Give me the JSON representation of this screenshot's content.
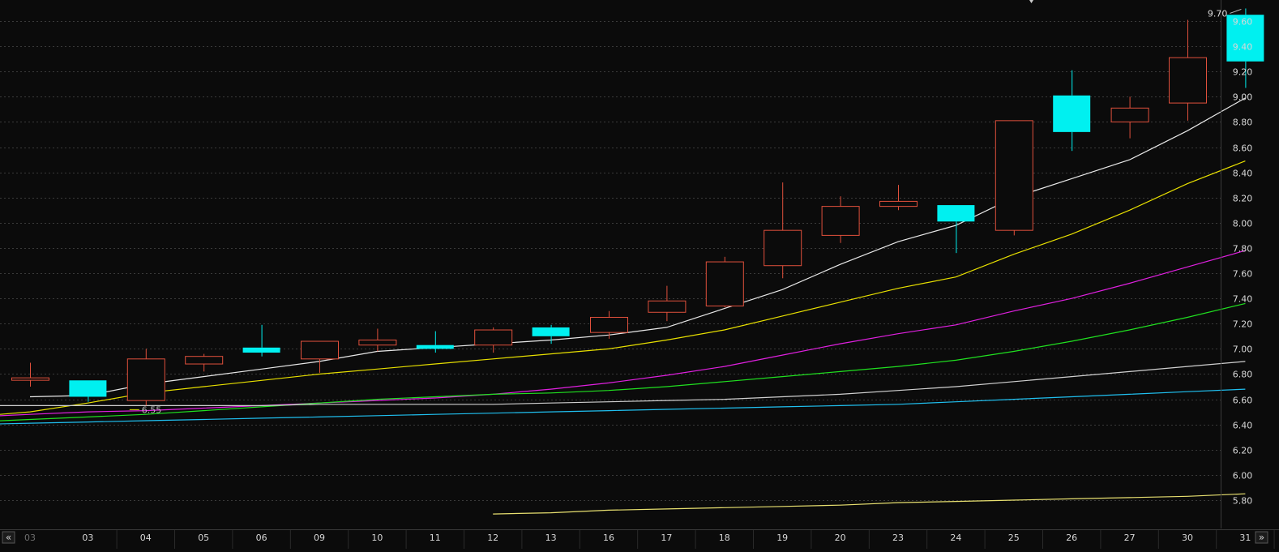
{
  "colors": {
    "background": "#0b0b0b",
    "grid": "#3a3a3a",
    "axis_text": "#d8d8d8",
    "axis_text_dim": "#6e6e6e",
    "up_candle": "#e0503c",
    "down_candle": "#00f0f0",
    "ma_white": "#e8e8e8",
    "ma_yellow": "#e8e000",
    "ma_magenta": "#e020e0",
    "ma_green": "#20e020",
    "ma_gray": "#d0d0d0",
    "ma_cyan": "#20c0f0",
    "ma_long_yellow": "#e8e070"
  },
  "navigation": {
    "left_icon": "double-chevron-left-icon",
    "right_icon": "double-chevron-right-icon",
    "left_symbol": "«",
    "right_symbol": "»"
  },
  "chart_data": {
    "type": "candlestick",
    "x_first_label": "03",
    "categories": [
      "03",
      "04",
      "05",
      "06",
      "09",
      "10",
      "11",
      "12",
      "13",
      "16",
      "17",
      "18",
      "19",
      "20",
      "23",
      "24",
      "25",
      "26",
      "27",
      "30",
      "31"
    ],
    "y_ticks": [
      "5.80",
      "6.00",
      "6.20",
      "6.40",
      "6.60",
      "6.80",
      "7.00",
      "7.20",
      "7.40",
      "7.60",
      "7.80",
      "8.00",
      "8.20",
      "8.40",
      "8.60",
      "8.80",
      "9.00",
      "9.20",
      "9.40",
      "9.60"
    ],
    "ylim": [
      5.7,
      9.75
    ],
    "grid": true,
    "first_candle": {
      "open": 6.77,
      "high": 6.89,
      "low": 6.7,
      "close": 6.77
    },
    "candles": [
      {
        "open": 6.75,
        "high": 6.75,
        "low": 6.58,
        "close": 6.62
      },
      {
        "open": 6.59,
        "high": 7.0,
        "low": 6.55,
        "close": 6.92
      },
      {
        "open": 6.88,
        "high": 6.96,
        "low": 6.82,
        "close": 6.94
      },
      {
        "open": 7.01,
        "high": 7.19,
        "low": 6.94,
        "close": 6.97
      },
      {
        "open": 6.92,
        "high": 7.05,
        "low": 6.81,
        "close": 7.06
      },
      {
        "open": 7.03,
        "high": 7.16,
        "low": 6.98,
        "close": 7.07
      },
      {
        "open": 7.03,
        "high": 7.14,
        "low": 6.97,
        "close": 7.0
      },
      {
        "open": 7.03,
        "high": 7.17,
        "low": 6.97,
        "close": 7.15
      },
      {
        "open": 7.17,
        "high": 7.19,
        "low": 7.04,
        "close": 7.1
      },
      {
        "open": 7.13,
        "high": 7.3,
        "low": 7.08,
        "close": 7.25
      },
      {
        "open": 7.29,
        "high": 7.5,
        "low": 7.22,
        "close": 7.38
      },
      {
        "open": 7.34,
        "high": 7.73,
        "low": 7.33,
        "close": 7.69
      },
      {
        "open": 7.66,
        "high": 8.32,
        "low": 7.56,
        "close": 7.94
      },
      {
        "open": 7.9,
        "high": 8.21,
        "low": 7.84,
        "close": 8.13
      },
      {
        "open": 8.13,
        "high": 8.3,
        "low": 8.1,
        "close": 8.17
      },
      {
        "open": 8.14,
        "high": 8.14,
        "low": 7.76,
        "close": 8.01
      },
      {
        "open": 7.94,
        "high": 8.81,
        "low": 7.9,
        "close": 8.81
      },
      {
        "open": 9.01,
        "high": 9.21,
        "low": 8.57,
        "close": 8.72
      },
      {
        "open": 8.8,
        "high": 9.0,
        "low": 8.67,
        "close": 8.91
      },
      {
        "open": 8.95,
        "high": 9.61,
        "low": 8.81,
        "close": 9.31
      },
      {
        "open": 9.65,
        "high": 9.7,
        "low": 9.07,
        "close": 9.28
      }
    ],
    "series": [
      {
        "color_key": "ma_white",
        "values": [
          6.62,
          6.63,
          6.72,
          6.78,
          6.84,
          6.9,
          6.98,
          7.01,
          7.04,
          7.07,
          7.11,
          7.17,
          7.32,
          7.47,
          7.67,
          7.85,
          7.98,
          8.2,
          8.35,
          8.5,
          8.73,
          8.99
        ]
      },
      {
        "color_key": "ma_yellow",
        "values": [
          6.48,
          6.5,
          6.57,
          6.65,
          6.7,
          6.75,
          6.8,
          6.84,
          6.88,
          6.92,
          6.96,
          7.0,
          7.07,
          7.15,
          7.26,
          7.37,
          7.48,
          7.57,
          7.75,
          7.91,
          8.1,
          8.31,
          8.49
        ]
      },
      {
        "color_key": "ma_magenta",
        "values": [
          6.45,
          6.46,
          6.48,
          6.5,
          6.51,
          6.53,
          6.55,
          6.57,
          6.59,
          6.61,
          6.64,
          6.68,
          6.73,
          6.79,
          6.86,
          6.95,
          7.04,
          7.12,
          7.19,
          7.3,
          7.4,
          7.52,
          7.65,
          7.78
        ]
      },
      {
        "color_key": "ma_green",
        "values": [
          6.41,
          6.42,
          6.44,
          6.46,
          6.48,
          6.51,
          6.54,
          6.57,
          6.6,
          6.62,
          6.64,
          6.65,
          6.67,
          6.7,
          6.74,
          6.78,
          6.82,
          6.86,
          6.91,
          6.98,
          7.06,
          7.15,
          7.25,
          7.36
        ]
      },
      {
        "color_key": "ma_gray",
        "values": [
          6.55,
          6.55,
          6.55,
          6.55,
          6.55,
          6.55,
          6.55,
          6.55,
          6.56,
          6.56,
          6.56,
          6.56,
          6.57,
          6.58,
          6.59,
          6.6,
          6.62,
          6.64,
          6.67,
          6.7,
          6.74,
          6.78,
          6.82,
          6.86,
          6.9
        ]
      },
      {
        "color_key": "ma_cyan",
        "values": [
          6.37,
          6.38,
          6.39,
          6.4,
          6.41,
          6.42,
          6.43,
          6.44,
          6.45,
          6.46,
          6.47,
          6.48,
          6.49,
          6.5,
          6.51,
          6.52,
          6.53,
          6.54,
          6.55,
          6.56,
          6.58,
          6.6,
          6.62,
          6.64,
          6.66,
          6.68
        ]
      },
      {
        "color_key": "ma_long_yellow",
        "values": [
          5.69,
          5.7,
          5.72,
          5.73,
          5.74,
          5.75,
          5.76,
          5.78,
          5.79,
          5.8,
          5.81,
          5.82,
          5.83,
          5.85
        ]
      }
    ],
    "annotations": [
      {
        "text": "6.55",
        "value": 6.55,
        "category_index": 1
      },
      {
        "text": "9.70",
        "value": 9.7,
        "category_index": 20
      }
    ]
  }
}
